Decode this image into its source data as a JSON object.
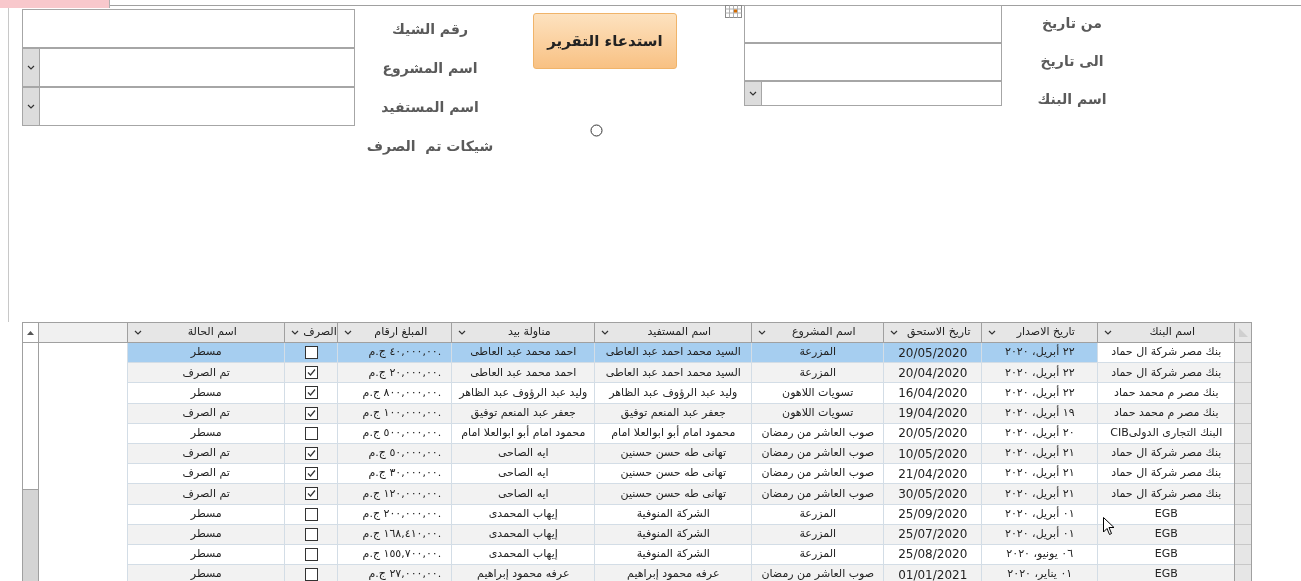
{
  "filters_left": [
    {
      "label": "رقم الشيك",
      "kind": "text"
    },
    {
      "label": "اسم المشروع",
      "kind": "combo"
    },
    {
      "label": "اسم المستفيد",
      "kind": "combo"
    },
    {
      "label": "شيكات تم  الصرف",
      "kind": "none"
    }
  ],
  "report_button": "استدعاء التقرير",
  "paid_only": {
    "selected": false
  },
  "filters_right": [
    {
      "label": "من تاريخ",
      "kind": "date"
    },
    {
      "label": "الى تاريخ",
      "kind": "text"
    },
    {
      "label": "اسم البنك",
      "kind": "combo"
    }
  ],
  "table": {
    "columns": [
      "اسم البنك",
      "تاريخ الاصدار",
      "تاريخ الاستحق",
      "اسم المشروع",
      "اسم المستفيد",
      "مناولة بيد",
      "المبلغ ارقام",
      "الصرف",
      "اسم الحالة"
    ],
    "rows": [
      {
        "selected": true,
        "status": "مسطر",
        "paid": false,
        "amount": "٤٠,٠٠٠,٠٠ ج.م.",
        "handed_by": "احمد محمد عبد العاطى",
        "beneficiary": "السيد محمد احمد عبد العاطى",
        "project": "المزرعة",
        "due_date": "20/05/2020",
        "issue_date": "٢٢ أبريل، ٢٠٢٠",
        "bank": "بنك مصر شركة ال حماد"
      },
      {
        "selected": false,
        "status": "تم الصرف",
        "paid": true,
        "amount": "٢٠,٠٠٠,٠٠ ج.م.",
        "handed_by": "احمد محمد عبد العاطى",
        "beneficiary": "السيد محمد احمد عبد العاطى",
        "project": "المزرعة",
        "due_date": "20/04/2020",
        "issue_date": "٢٢ أبريل، ٢٠٢٠",
        "bank": "بنك مصر شركة ال حماد"
      },
      {
        "selected": false,
        "status": "مسطر",
        "paid": true,
        "amount": "٨٠٠,٠٠٠,٠٠ ج.م.",
        "handed_by": "وليد عبد الرؤوف عبد الظاهر",
        "beneficiary": "وليد عبد الرؤوف عبد الظاهر",
        "project": "تسويات اللاهون",
        "due_date": "16/04/2020",
        "issue_date": "٢٢ أبريل، ٢٠٢٠",
        "bank": "بنك مصر م محمد حماد"
      },
      {
        "selected": false,
        "status": "تم الصرف",
        "paid": true,
        "amount": "١٠٠,٠٠٠,٠٠ ج.م.",
        "handed_by": "جعفر عبد المنعم توفيق",
        "beneficiary": "جعفر عبد المنعم توفيق",
        "project": "تسويات اللاهون",
        "due_date": "19/04/2020",
        "issue_date": "١٩ أبريل، ٢٠٢٠",
        "bank": "بنك مصر م محمد حماد"
      },
      {
        "selected": false,
        "status": "مسطر",
        "paid": false,
        "amount": "٥٠٠,٠٠٠,٠٠ ج.م.",
        "handed_by": "محمود امام أبو ابوالعلا امام",
        "beneficiary": "محمود امام أبو ابوالعلا امام",
        "project": "صوب العاشر من رمضان",
        "due_date": "20/05/2020",
        "issue_date": "٢٠ أبريل، ٢٠٢٠",
        "bank": "البنك التجارى الدولىCIB"
      },
      {
        "selected": false,
        "status": "تم الصرف",
        "paid": true,
        "amount": "٥٠,٠٠٠,٠٠ ج.م.",
        "handed_by": "ايه الصاحى",
        "beneficiary": "تهانى طه حسن حسنين",
        "project": "صوب العاشر من رمضان",
        "due_date": "10/05/2020",
        "issue_date": "٢١ أبريل، ٢٠٢٠",
        "bank": "بنك مصر شركة ال حماد"
      },
      {
        "selected": false,
        "status": "تم الصرف",
        "paid": true,
        "amount": "٣٠,٠٠٠,٠٠ ج.م.",
        "handed_by": "ايه الصاحى",
        "beneficiary": "تهانى طه حسن حسنين",
        "project": "صوب العاشر من رمضان",
        "due_date": "21/04/2020",
        "issue_date": "٢١ أبريل، ٢٠٢٠",
        "bank": "بنك مصر شركة ال حماد"
      },
      {
        "selected": false,
        "status": "تم الصرف",
        "paid": true,
        "amount": "١٢٠,٠٠٠,٠٠ ج.م.",
        "handed_by": "ايه الصاحى",
        "beneficiary": "تهانى طه حسن حسنين",
        "project": "صوب العاشر من رمضان",
        "due_date": "30/05/2020",
        "issue_date": "٢١ أبريل، ٢٠٢٠",
        "bank": "بنك مصر شركة ال حماد"
      },
      {
        "selected": false,
        "status": "مسطر",
        "paid": false,
        "amount": "٢٠٠,٠٠٠,٠٠ ج.م.",
        "handed_by": "إيهاب المحمدى",
        "beneficiary": "الشركة المنوفية",
        "project": "المزرعة",
        "due_date": "25/09/2020",
        "issue_date": "٠١ أبريل، ٢٠٢٠",
        "bank": "EGB"
      },
      {
        "selected": false,
        "status": "مسطر",
        "paid": false,
        "amount": "١٦٨,٤١٠,٠٠ ج.م.",
        "handed_by": "إيهاب المحمدى",
        "beneficiary": "الشركة المنوفية",
        "project": "المزرعة",
        "due_date": "25/07/2020",
        "issue_date": "٠١ أبريل، ٢٠٢٠",
        "bank": "EGB"
      },
      {
        "selected": false,
        "status": "مسطر",
        "paid": false,
        "amount": "١٥٥,٧٠٠,٠٠ ج.م.",
        "handed_by": "إيهاب المحمدى",
        "beneficiary": "الشركة المنوفية",
        "project": "المزرعة",
        "due_date": "25/08/2020",
        "issue_date": "٠٦ يونيو، ٢٠٢٠",
        "bank": "EGB"
      },
      {
        "selected": false,
        "status": "مسطر",
        "paid": false,
        "amount": "٢٧,٠٠٠,٠٠ ج.م.",
        "handed_by": "عرفه محمود إبراهيم",
        "beneficiary": "عرفه محمود إبراهيم",
        "project": "صوب العاشر من رمضان",
        "due_date": "01/01/2021",
        "issue_date": "٠١ يناير، ٢٠٢٠",
        "bank": "EGB"
      }
    ]
  }
}
